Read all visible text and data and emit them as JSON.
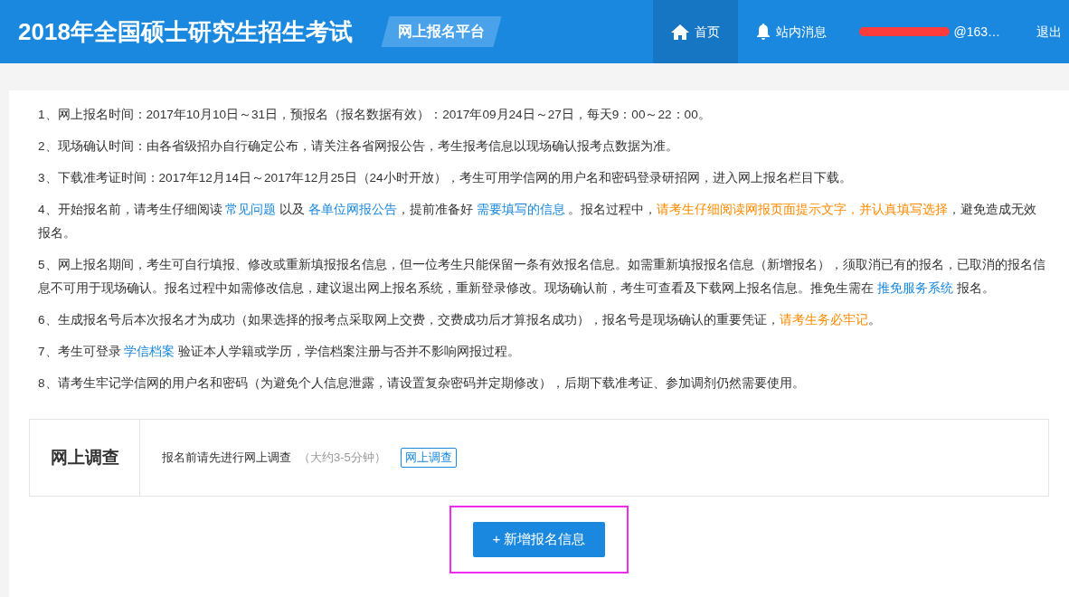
{
  "header": {
    "title": "2018年全国硕士研究生招生考试",
    "platform": "网上报名平台",
    "nav": [
      {
        "label": "首页",
        "kind": "home",
        "selected": true
      },
      {
        "label": "站内消息",
        "kind": "bell",
        "selected": false
      }
    ],
    "user": {
      "text": "@163…",
      "redacted": true
    },
    "logout": "退出"
  },
  "notices": [
    [
      {
        "kind": "plain",
        "text": "1、网上报名时间：2017年10月10日～31日，预报名（报名数据有效）：2017年09月24日～27日，每天9：00～22：00。"
      }
    ],
    [
      {
        "kind": "plain",
        "text": "2、现场确认时间：由各省级招办自行确定公布，请关注各省网报公告，考生报考信息以现场确认报考点数据为准。"
      }
    ],
    [
      {
        "kind": "plain",
        "text": "3、下载准考证时间：2017年12月14日～2017年12月25日（24小时开放），考生可用学信网的用户名和密码登录研招网，进入网上报名栏目下载。"
      }
    ],
    [
      {
        "kind": "plain",
        "text": "4、开始报名前，请考生仔细阅读 "
      },
      {
        "kind": "link",
        "text": "常见问题"
      },
      {
        "kind": "plain",
        "text": " 以及 "
      },
      {
        "kind": "link",
        "text": "各单位网报公告"
      },
      {
        "kind": "plain",
        "text": "，提前准备好 "
      },
      {
        "kind": "link",
        "text": "需要填写的信息"
      },
      {
        "kind": "plain",
        "text": " 。报名过程中，"
      },
      {
        "kind": "warn",
        "text": "请考生仔细阅读网报页面提示文字，并认真填写选择"
      },
      {
        "kind": "plain",
        "text": "，避免造成无效报名。"
      }
    ],
    [
      {
        "kind": "plain",
        "text": "5、网上报名期间，考生可自行填报、修改或重新填报报名信息，但一位考生只能保留一条有效报名信息。如需重新填报报名信息（新增报名），须取消已有的报名，已取消的报名信息不可用于现场确认。报名过程中如需修改信息，建议退出网上报名系统，重新登录修改。现场确认前，考生可查看及下载网上报名信息。推免生需在 "
      },
      {
        "kind": "link",
        "text": "推免服务系统"
      },
      {
        "kind": "plain",
        "text": " 报名。"
      }
    ],
    [
      {
        "kind": "plain",
        "text": "6、生成报名号后本次报名才为成功（如果选择的报考点采取网上交费，交费成功后才算报名成功），报名号是现场确认的重要凭证，"
      },
      {
        "kind": "warn",
        "text": "请考生务必牢记"
      },
      {
        "kind": "plain",
        "text": "。"
      }
    ],
    [
      {
        "kind": "plain",
        "text": "7、考生可登录 "
      },
      {
        "kind": "link",
        "text": "学信档案"
      },
      {
        "kind": "plain",
        "text": " 验证本人学籍或学历，学信档案注册与否并不影响网报过程。"
      }
    ],
    [
      {
        "kind": "plain",
        "text": "8、请考生牢记学信网的用户名和密码（为避免个人信息泄露，请设置复杂密码并定期修改），后期下载准考证、参加调剂仍然需要使用。"
      }
    ]
  ],
  "survey": {
    "heading": "网上调查",
    "text": "报名前请先进行网上调查",
    "hint": "（大约3-5分钟）",
    "button": "网上调查"
  },
  "add_button": {
    "label": "+ 新增报名信息",
    "highlighted": true
  }
}
